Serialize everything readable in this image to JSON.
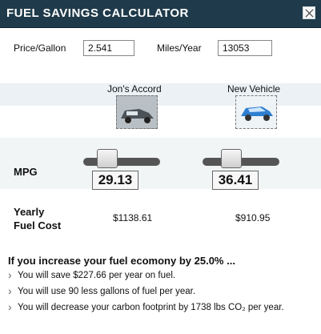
{
  "title": "FUEL SAVINGS CALCULATOR",
  "inputs": {
    "price_label": "Price/Gallon",
    "price_value": "2.541",
    "miles_label": "Miles/Year",
    "miles_value": "13053"
  },
  "vehicles": [
    {
      "name": "Jon's Accord",
      "mpg": "29.13",
      "yearly_cost": "$1138.61",
      "mpg_slider_fraction": 0.3
    },
    {
      "name": "New Vehicle",
      "mpg": "36.41",
      "yearly_cost": "$910.95",
      "mpg_slider_fraction": 0.35
    }
  ],
  "labels": {
    "mpg": "MPG",
    "yearly_line1": "Yearly",
    "yearly_line2": "Fuel Cost"
  },
  "results": {
    "headline": "If you increase your fuel ecomony by 25.0% ...",
    "items": [
      "You will save $227.66 per year on fuel.",
      "You will use 90 less gallons of fuel per year.",
      "You will decrease your carbon footprint by 1738 lbs CO₂ per year."
    ]
  },
  "icons": [
    "close-icon",
    "car-photo",
    "car-icon"
  ],
  "colors": {
    "titlebar": "#1f3a4a",
    "car_blue": "#2f7fd0"
  }
}
